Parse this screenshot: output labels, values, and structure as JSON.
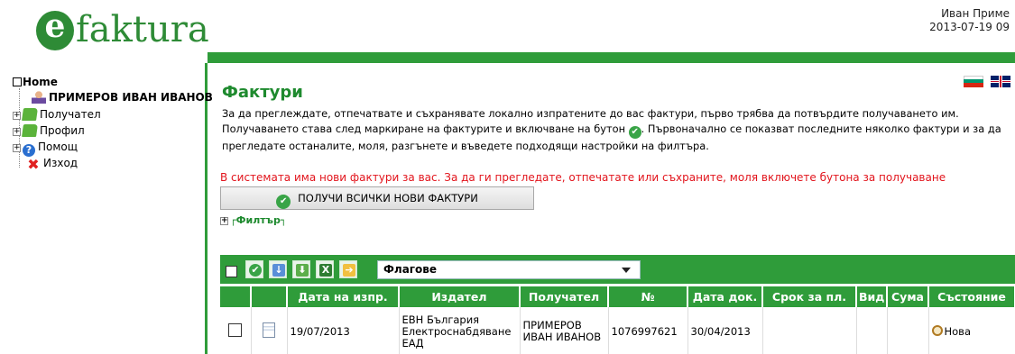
{
  "header": {
    "logo_letter": "e",
    "logo_text": "faktura",
    "user_name": "Иван Приме",
    "datetime": "2013-07-19 09"
  },
  "nav": {
    "home": "Home",
    "items": [
      {
        "label": "ПРИМЕРОВ ИВАН ИВАНОВ",
        "icon": "user-icon"
      },
      {
        "label": "Получател",
        "icon": "folder-icon"
      },
      {
        "label": "Профил",
        "icon": "folder-icon"
      },
      {
        "label": "Помощ",
        "icon": "help-icon"
      },
      {
        "label": "Изход",
        "icon": "exit-icon"
      }
    ]
  },
  "main": {
    "title": "Фактури",
    "intro_part1": "За да преглеждате, отпечатвате и съхранявате локално изпратените до вас фактури, първо трябва да потвърдите получаването им. Получаването става след маркиране на фактурите и включване на бутон",
    "intro_part2": ". Първоначално се показват последните няколко фактури и за да прегледате останалите, моля, разгънете и въведете подходящи настройки на филтъра.",
    "alert": "В системата има нови фактури за вас. За да ги прегледате, отпечатате или съхраните, моля включете бутона за получаване",
    "get_button": "ПОЛУЧИ ВСИЧКИ НОВИ ФАКТУРИ",
    "filter_label": "Филтър"
  },
  "toolbar": {
    "select_value": "Флагове"
  },
  "table": {
    "headers": [
      "Дата на изпр.",
      "Издател",
      "Получател",
      "№",
      "Дата док.",
      "Срок за пл.",
      "Вид",
      "Сума",
      "Състояние"
    ],
    "rows": [
      {
        "date_sent": "19/07/2013",
        "issuer": "ЕВН България Електроснабдяване ЕАД",
        "recipient": "ПРИМЕРОВ ИВАН ИВАНОВ",
        "number": "1076997621",
        "doc_date": "30/04/2013",
        "due": "",
        "kind": "",
        "amount": "",
        "status": "Нова"
      }
    ]
  },
  "colors": {
    "brand_green": "#2f9c3a",
    "alert_red": "#e2141c"
  }
}
